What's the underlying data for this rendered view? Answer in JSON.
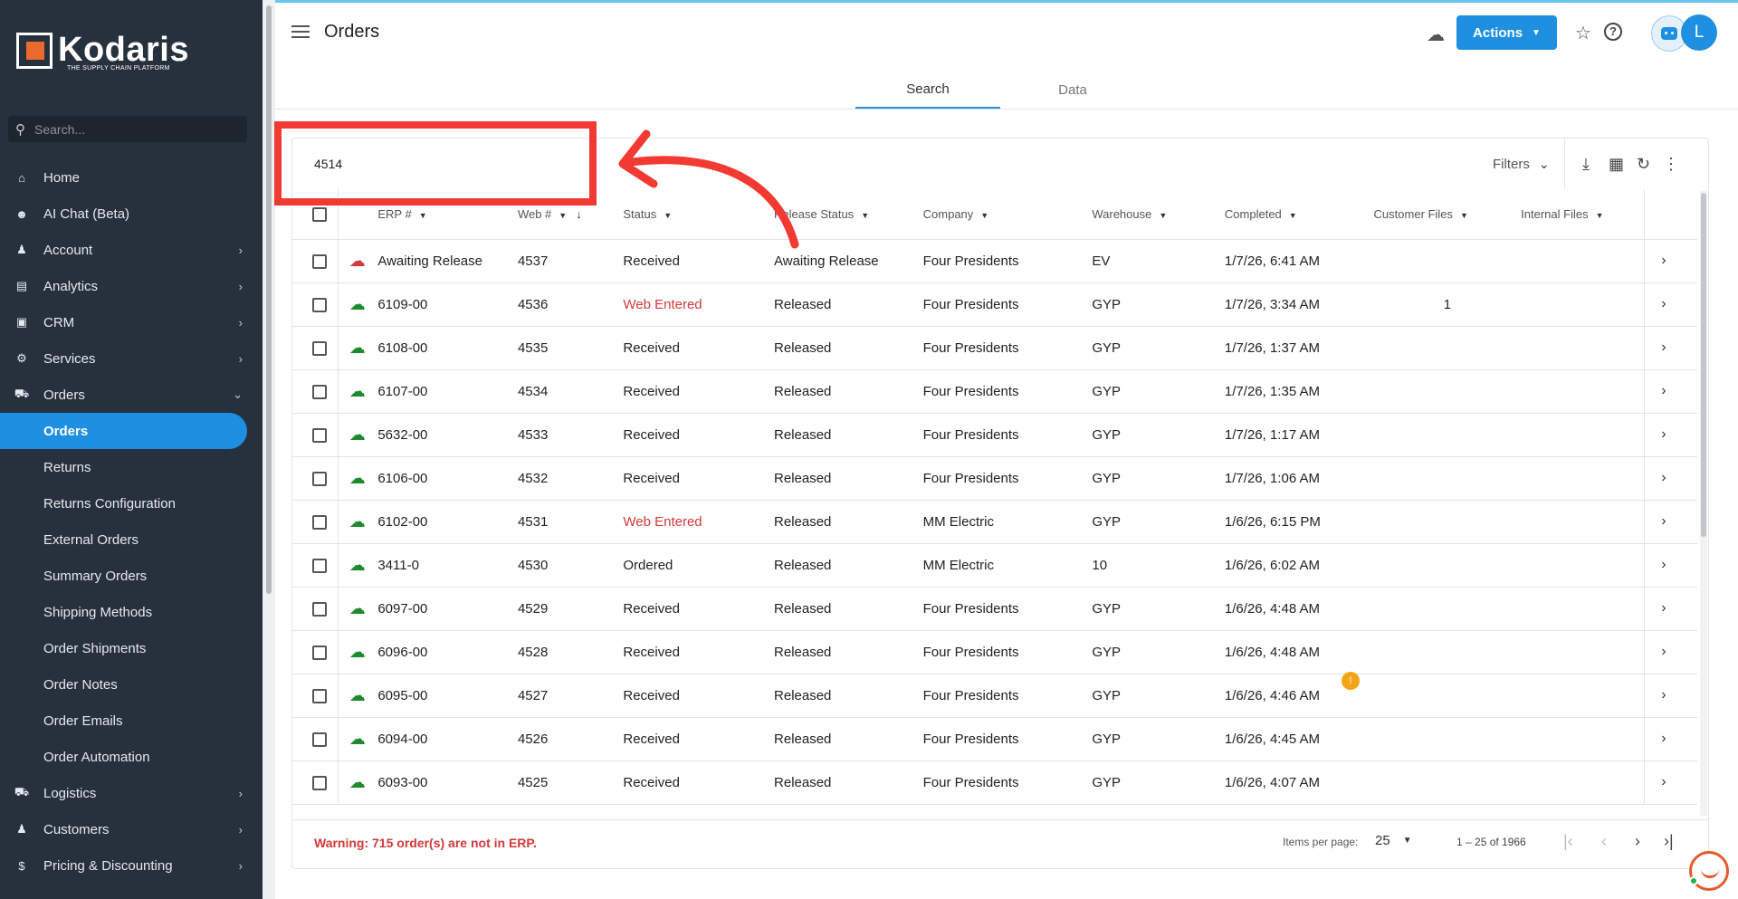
{
  "app": {
    "name": "Kodaris",
    "tagline": "THE SUPPLY CHAIN PLATFORM"
  },
  "sidebar": {
    "search_placeholder": "Search...",
    "items": [
      {
        "label": "Home",
        "icon": "home-icon",
        "has_chevron": false
      },
      {
        "label": "AI Chat (Beta)",
        "icon": "robot-icon",
        "has_chevron": false
      },
      {
        "label": "Account",
        "icon": "person-icon",
        "has_chevron": true
      },
      {
        "label": "Analytics",
        "icon": "chart-icon",
        "has_chevron": true
      },
      {
        "label": "CRM",
        "icon": "contact-card-icon",
        "has_chevron": true
      },
      {
        "label": "Services",
        "icon": "services-icon",
        "has_chevron": true
      },
      {
        "label": "Orders",
        "icon": "truck-icon",
        "has_chevron": true,
        "expanded": true
      }
    ],
    "order_subitems": [
      "Orders",
      "Returns",
      "Returns Configuration",
      "External Orders",
      "Summary Orders",
      "Shipping Methods",
      "Order Shipments",
      "Order Notes",
      "Order Emails",
      "Order Automation"
    ],
    "bottom_items": [
      {
        "label": "Logistics",
        "icon": "logistics-icon"
      },
      {
        "label": "Customers",
        "icon": "people-icon"
      },
      {
        "label": "Pricing & Discounting",
        "icon": "dollar-icon"
      }
    ]
  },
  "header": {
    "title": "Orders",
    "actions_label": "Actions",
    "avatar_letter": "L"
  },
  "tabs": [
    "Search",
    "Data"
  ],
  "grid": {
    "search_value": "4514",
    "filters_label": "Filters",
    "columns": [
      "ERP #",
      "Web #",
      "Status",
      "Release Status",
      "Company",
      "Warehouse",
      "Completed",
      "Customer Files",
      "Internal Files"
    ],
    "rows": [
      {
        "sync": "red",
        "erp": "Awaiting Release",
        "web": "4537",
        "status": "Received",
        "status_color": "normal",
        "release": "Awaiting Release",
        "company": "Four Presidents",
        "warehouse": "EV",
        "completed": "1/7/26, 6:41 AM",
        "customer_files": "",
        "internal_files": ""
      },
      {
        "sync": "green",
        "erp": "6109-00",
        "web": "4536",
        "status": "Web Entered",
        "status_color": "red",
        "release": "Released",
        "company": "Four Presidents",
        "warehouse": "GYP",
        "completed": "1/7/26, 3:34 AM",
        "customer_files": "1",
        "internal_files": ""
      },
      {
        "sync": "green",
        "erp": "6108-00",
        "web": "4535",
        "status": "Received",
        "status_color": "normal",
        "release": "Released",
        "company": "Four Presidents",
        "warehouse": "GYP",
        "completed": "1/7/26, 1:37 AM",
        "customer_files": "",
        "internal_files": ""
      },
      {
        "sync": "green",
        "erp": "6107-00",
        "web": "4534",
        "status": "Received",
        "status_color": "normal",
        "release": "Released",
        "company": "Four Presidents",
        "warehouse": "GYP",
        "completed": "1/7/26, 1:35 AM",
        "customer_files": "",
        "internal_files": ""
      },
      {
        "sync": "green",
        "erp": "5632-00",
        "web": "4533",
        "status": "Received",
        "status_color": "normal",
        "release": "Released",
        "company": "Four Presidents",
        "warehouse": "GYP",
        "completed": "1/7/26, 1:17 AM",
        "customer_files": "",
        "internal_files": ""
      },
      {
        "sync": "green",
        "erp": "6106-00",
        "web": "4532",
        "status": "Received",
        "status_color": "normal",
        "release": "Released",
        "company": "Four Presidents",
        "warehouse": "GYP",
        "completed": "1/7/26, 1:06 AM",
        "customer_files": "",
        "internal_files": ""
      },
      {
        "sync": "green",
        "erp": "6102-00",
        "web": "4531",
        "status": "Web Entered",
        "status_color": "red",
        "release": "Released",
        "company": "MM Electric",
        "warehouse": "GYP",
        "completed": "1/6/26, 6:15 PM",
        "customer_files": "",
        "internal_files": ""
      },
      {
        "sync": "green",
        "erp": "3411-0",
        "web": "4530",
        "status": "Ordered",
        "status_color": "normal",
        "release": "Released",
        "company": "MM Electric",
        "warehouse": "10",
        "completed": "1/6/26, 6:02 AM",
        "customer_files": "",
        "internal_files": ""
      },
      {
        "sync": "green",
        "erp": "6097-00",
        "web": "4529",
        "status": "Received",
        "status_color": "normal",
        "release": "Released",
        "company": "Four Presidents",
        "warehouse": "GYP",
        "completed": "1/6/26, 4:48 AM",
        "customer_files": "",
        "internal_files": ""
      },
      {
        "sync": "green",
        "erp": "6096-00",
        "web": "4528",
        "status": "Received",
        "status_color": "normal",
        "release": "Released",
        "company": "Four Presidents",
        "warehouse": "GYP",
        "completed": "1/6/26, 4:48 AM",
        "customer_files": "",
        "internal_files": ""
      },
      {
        "sync": "green",
        "erp": "6095-00",
        "web": "4527",
        "status": "Received",
        "status_color": "normal",
        "release": "Released",
        "company": "Four Presidents",
        "warehouse": "GYP",
        "completed": "1/6/26, 4:46 AM",
        "customer_files": "",
        "internal_files": ""
      },
      {
        "sync": "green",
        "erp": "6094-00",
        "web": "4526",
        "status": "Received",
        "status_color": "normal",
        "release": "Released",
        "company": "Four Presidents",
        "warehouse": "GYP",
        "completed": "1/6/26, 4:45 AM",
        "customer_files": "",
        "internal_files": ""
      },
      {
        "sync": "green",
        "erp": "6093-00",
        "web": "4525",
        "status": "Received",
        "status_color": "normal",
        "release": "Released",
        "company": "Four Presidents",
        "warehouse": "GYP",
        "completed": "1/6/26, 4:07 AM",
        "customer_files": "",
        "internal_files": ""
      }
    ],
    "warning": "Warning: 715 order(s) are not in ERP.",
    "items_per_page_label": "Items per page:",
    "items_per_page": "25",
    "range_label": "1 – 25 of 1966"
  },
  "colors": {
    "accent": "#1e8fe1",
    "sidebar_bg": "#27313d",
    "warning": "#d23a3a",
    "sync_ok": "#1e8a2e",
    "sync_error": "#d23a3a",
    "annotation": "#f23a33"
  }
}
